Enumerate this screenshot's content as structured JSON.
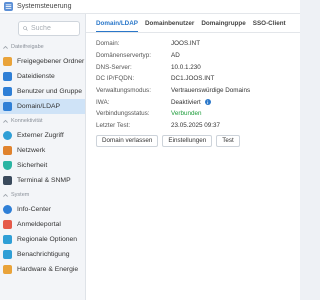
{
  "window": {
    "title": "Systemsteuerung"
  },
  "search": {
    "placeholder": "Suche"
  },
  "sidebar": {
    "sections": [
      {
        "label": "Dateifreigabe",
        "items": [
          {
            "label": "Freigegebener Ordner",
            "color": "#e9a33a",
            "icon": "folder-icon"
          },
          {
            "label": "Dateidienste",
            "color": "#2f7fd6",
            "icon": "file-services-icon"
          },
          {
            "label": "Benutzer und Gruppe",
            "color": "#2f7fd6",
            "icon": "users-icon"
          },
          {
            "label": "Domain/LDAP",
            "color": "#2f7fd6",
            "icon": "domain-icon",
            "active": true
          }
        ]
      },
      {
        "label": "Konnektivität",
        "items": [
          {
            "label": "Externer Zugriff",
            "color": "#2f9fd6",
            "icon": "globe-icon"
          },
          {
            "label": "Netzwerk",
            "color": "#e0832e",
            "icon": "network-icon"
          },
          {
            "label": "Sicherheit",
            "color": "#2bb5a3",
            "icon": "shield-icon"
          },
          {
            "label": "Terminal & SNMP",
            "color": "#3a4a5c",
            "icon": "terminal-icon"
          }
        ]
      },
      {
        "label": "System",
        "items": [
          {
            "label": "Info-Center",
            "color": "#2f7fd6",
            "icon": "info-icon"
          },
          {
            "label": "Anmeldeportal",
            "color": "#e55a4a",
            "icon": "login-portal-icon"
          },
          {
            "label": "Regionale Optionen",
            "color": "#2f9fd6",
            "icon": "regional-icon"
          },
          {
            "label": "Benachrichtigung",
            "color": "#2f9fd6",
            "icon": "notification-icon"
          },
          {
            "label": "Hardware & Energie",
            "color": "#e9a33a",
            "icon": "hardware-icon"
          }
        ]
      }
    ]
  },
  "main": {
    "tabs": [
      "Domain/LDAP",
      "Domainbenutzer",
      "Domaingruppe",
      "SSO-Client"
    ],
    "rows": [
      {
        "key": "Domain:",
        "value": "JOOS.INT"
      },
      {
        "key": "Domänenservertyp:",
        "value": "AD"
      },
      {
        "key": "DNS-Server:",
        "value": "10.0.1.230"
      },
      {
        "key": "DC IP/FQDN:",
        "value": "DC1.JOOS.INT"
      },
      {
        "key": "Verwaltungsmodus:",
        "value": "Vertrauenswürdige Domains"
      },
      {
        "key": "IWA:",
        "value": "Deaktiviert"
      },
      {
        "key": "Verbindungsstatus:",
        "value": "Verbunden"
      },
      {
        "key": "Letzter Test:",
        "value": "23.05.2025 09:37"
      }
    ],
    "buttons": [
      "Domain verlassen",
      "Einstellungen",
      "Test"
    ]
  },
  "colors": {
    "accent": "#2a77c9",
    "active_bg": "#cfe3f7",
    "success": "#1a9b38"
  }
}
